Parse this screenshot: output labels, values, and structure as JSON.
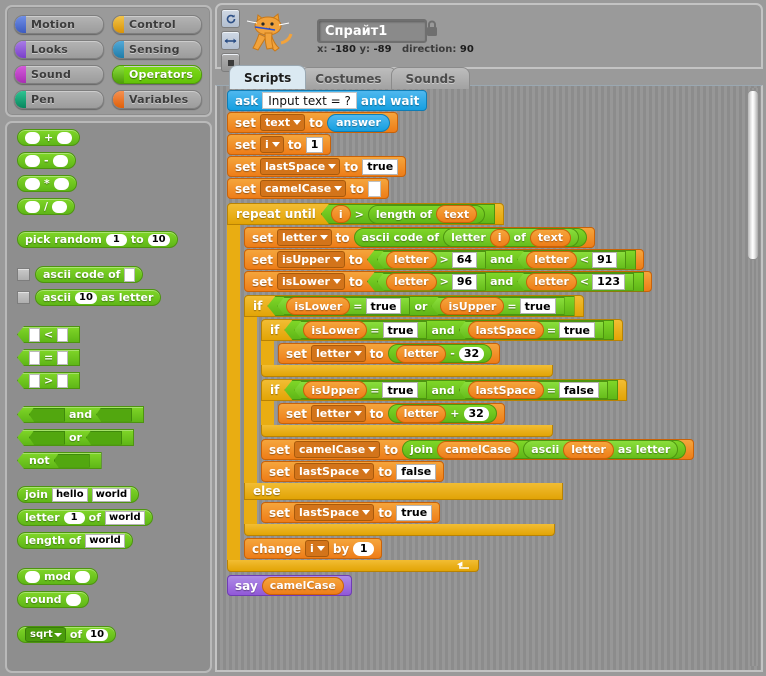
{
  "categories": [
    {
      "name": "Motion",
      "color": "#4a6cd4",
      "selected": false
    },
    {
      "name": "Control",
      "color": "#e6a81e",
      "selected": false
    },
    {
      "name": "Looks",
      "color": "#8a55d7",
      "selected": false
    },
    {
      "name": "Sensing",
      "color": "#2e8eb8",
      "selected": false
    },
    {
      "name": "Sound",
      "color": "#bb42c3",
      "selected": false
    },
    {
      "name": "Operators",
      "color": "#5cb712",
      "selected": true
    },
    {
      "name": "Pen",
      "color": "#0e9a6c",
      "selected": false
    },
    {
      "name": "Variables",
      "color": "#ee7d16",
      "selected": false
    }
  ],
  "palette": {
    "arithmetic": [
      "+",
      "-",
      "*",
      "/"
    ],
    "pick_random": {
      "label1": "pick random",
      "from": "1",
      "label2": "to",
      "to": "10"
    },
    "ascii_code_of": {
      "label": "ascii code of",
      "checked": false
    },
    "ascii_as_letter": {
      "label1": "ascii",
      "value": "10",
      "label2": "as letter",
      "checked": false
    },
    "comparisons": [
      "<",
      "=",
      ">"
    ],
    "and_label": "and",
    "or_label": "or",
    "not_label": "not",
    "join": {
      "label": "join",
      "a": "hello",
      "b": "world"
    },
    "letter_of": {
      "label1": "letter",
      "index": "1",
      "label2": "of",
      "text": "world"
    },
    "length_of": {
      "label": "length of",
      "text": "world"
    },
    "mod_label": "mod",
    "round_label": "round",
    "sqrt_of": {
      "func": "sqrt",
      "label": "of",
      "value": "10"
    }
  },
  "sprite": {
    "name": "Спрайт1",
    "x_label": "x:",
    "x_value": "-180",
    "y_label": "y:",
    "y_value": "-89",
    "direction_label": "direction:",
    "direction_value": "90",
    "rotation_buttons": [
      "rotate-icon",
      "flip-horizontal-icon",
      "no-rotate-icon"
    ],
    "lock_icon": "lock-icon"
  },
  "tabs": [
    {
      "label": "Scripts",
      "active": true
    },
    {
      "label": "Costumes",
      "active": false
    },
    {
      "label": "Sounds",
      "active": false
    }
  ],
  "script": {
    "ask": {
      "word1": "ask",
      "prompt": "Input text = ?",
      "word2": "and wait"
    },
    "set_text": {
      "set": "set",
      "var": "text",
      "to": "to",
      "value": "answer"
    },
    "set_i": {
      "set": "set",
      "var": "i",
      "to": "to",
      "value": "1"
    },
    "set_lastspace": {
      "set": "set",
      "var": "lastSpace",
      "to": "to",
      "value": "true"
    },
    "set_camelcase": {
      "set": "set",
      "var": "camelCase",
      "to": "to",
      "value": ""
    },
    "repeat_until": {
      "label": "repeat until",
      "left": "i",
      "op": ">",
      "fn": "length of",
      "arg": "text"
    },
    "set_letter_ascii": {
      "set": "set",
      "var": "letter",
      "to": "to",
      "fn": "ascii code of",
      "fn2": "letter",
      "idx": "i",
      "of": "of",
      "text": "text"
    },
    "set_isupper": {
      "set": "set",
      "var": "isUpper",
      "to": "to",
      "a": "letter",
      "op1": ">",
      "v1": "64",
      "conj": "and",
      "b": "letter",
      "op2": "<",
      "v2": "91"
    },
    "set_islower": {
      "set": "set",
      "var": "isLower",
      "to": "to",
      "a": "letter",
      "op1": ">",
      "v1": "96",
      "conj": "and",
      "b": "letter",
      "op2": "<",
      "v2": "123"
    },
    "if_outer": {
      "label": "if",
      "a": "isLower",
      "op1": "=",
      "v1": "true",
      "conj": "or",
      "b": "isUpper",
      "op2": "=",
      "v2": "true"
    },
    "if_lower": {
      "label": "if",
      "a": "isLower",
      "op1": "=",
      "v1": "true",
      "conj": "and",
      "b": "lastSpace",
      "op2": "=",
      "v2": "true"
    },
    "set_letter_minus": {
      "set": "set",
      "var": "letter",
      "to": "to",
      "a": "letter",
      "op": "-",
      "v": "32"
    },
    "if_upper": {
      "label": "if",
      "a": "isUpper",
      "op1": "=",
      "v1": "true",
      "conj": "and",
      "b": "lastSpace",
      "op2": "=",
      "v2": "false"
    },
    "set_letter_plus": {
      "set": "set",
      "var": "letter",
      "to": "to",
      "a": "letter",
      "op": "+",
      "v": "32"
    },
    "set_camel_join": {
      "set": "set",
      "var": "camelCase",
      "to": "to",
      "join": "join",
      "a": "camelCase",
      "fn": "ascii",
      "b": "letter",
      "tail": "as letter"
    },
    "set_lastspace_false": {
      "set": "set",
      "var": "lastSpace",
      "to": "to",
      "value": "false"
    },
    "else_label": "else",
    "set_lastspace_true": {
      "set": "set",
      "var": "lastSpace",
      "to": "to",
      "value": "true"
    },
    "change_i": {
      "label": "change",
      "var": "i",
      "by": "by",
      "value": "1"
    },
    "say": {
      "label": "say",
      "value": "camelCase"
    }
  }
}
